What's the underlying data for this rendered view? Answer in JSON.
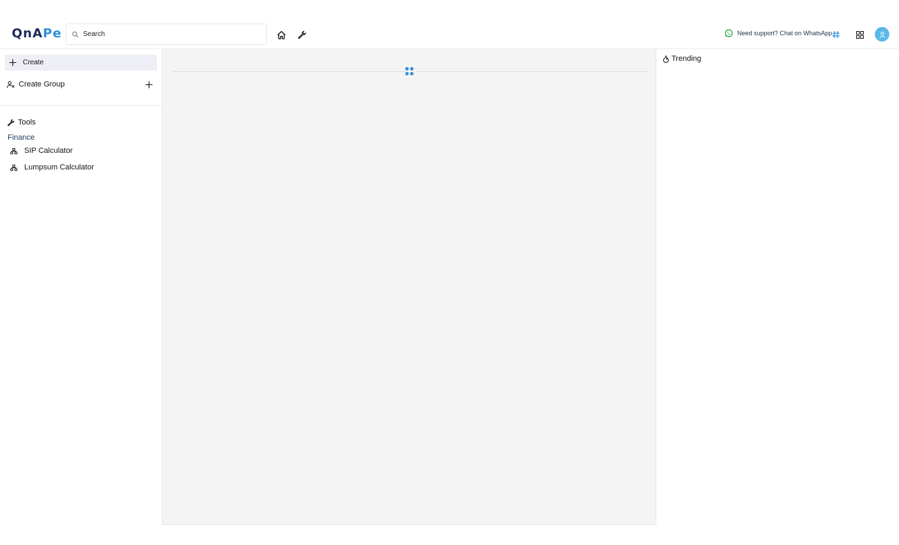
{
  "header": {
    "logo_part1": "QnA",
    "logo_part2": "Pe",
    "search_placeholder": "Search",
    "support_text": "Need support? Chat on WhatsApp.",
    "icons": [
      "home-icon",
      "wrench-icon",
      "whatsapp-icon",
      "hashtag-icon",
      "grid-icon",
      "user-avatar-icon"
    ]
  },
  "sidebar": {
    "create_label": "Create",
    "create_group_label": "Create Group",
    "tools_heading": "Tools",
    "finance_label": "Finance",
    "tools": [
      {
        "label": "SIP Calculator"
      },
      {
        "label": "Lumpsum Calculator"
      }
    ]
  },
  "right": {
    "trending_label": "Trending"
  },
  "colors": {
    "brand_dark": "#1e2a5a",
    "brand_light": "#2e8fd8",
    "whatsapp": "#25a244",
    "accent": "#3b8ce0",
    "avatar_bg": "#5bb8e8"
  }
}
